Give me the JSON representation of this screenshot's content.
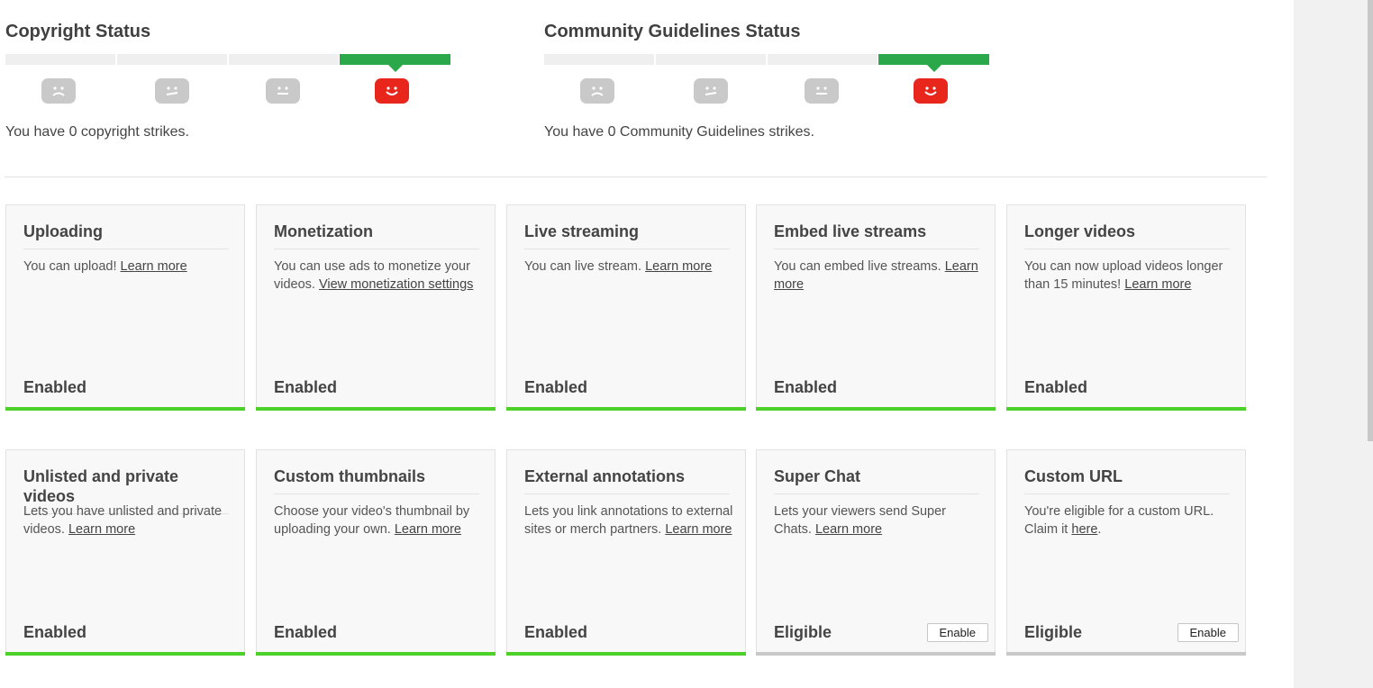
{
  "copyright": {
    "title": "Copyright Status",
    "strikes_text": "You have 0 copyright strikes.",
    "level": 4
  },
  "community": {
    "title": "Community Guidelines Status",
    "strikes_text": "You have 0 Community Guidelines strikes.",
    "level": 4
  },
  "colors": {
    "accent_green": "#2aa84a",
    "enabled_green": "#4ed02a",
    "red": "#e8261c"
  },
  "features": [
    {
      "title": "Uploading",
      "desc": "You can upload! ",
      "link": "Learn more",
      "after": "",
      "state": "Enabled"
    },
    {
      "title": "Monetization",
      "desc": "You can use ads to monetize your videos. ",
      "link": "View monetization settings",
      "after": "",
      "state": "Enabled"
    },
    {
      "title": "Live streaming",
      "desc": "You can live stream. ",
      "link": "Learn more",
      "after": "",
      "state": "Enabled"
    },
    {
      "title": "Embed live streams",
      "desc": "You can embed live streams. ",
      "link": "Learn more",
      "after": "",
      "state": "Enabled"
    },
    {
      "title": "Longer videos",
      "desc": "You can now upload videos longer than 15 minutes! ",
      "link": "Learn more",
      "after": "",
      "state": "Enabled"
    },
    {
      "title": "Unlisted and private videos",
      "desc": "Lets you have unlisted and private videos. ",
      "link": "Learn more",
      "after": "",
      "state": "Enabled"
    },
    {
      "title": "Custom thumbnails",
      "desc": "Choose your video's thumbnail by uploading your own. ",
      "link": "Learn more",
      "after": "",
      "state": "Enabled"
    },
    {
      "title": "External annotations",
      "desc": "Lets you link annotations to external sites or merch partners. ",
      "link": "Learn more",
      "after": "",
      "state": "Enabled"
    },
    {
      "title": "Super Chat",
      "desc": "Lets your viewers send Super Chats. ",
      "link": "Learn more",
      "after": "",
      "state": "Eligible",
      "button": "Enable"
    },
    {
      "title": "Custom URL",
      "desc": "You're eligible for a custom URL. Claim it ",
      "link": "here",
      "after": ".",
      "state": "Eligible",
      "button": "Enable"
    }
  ]
}
